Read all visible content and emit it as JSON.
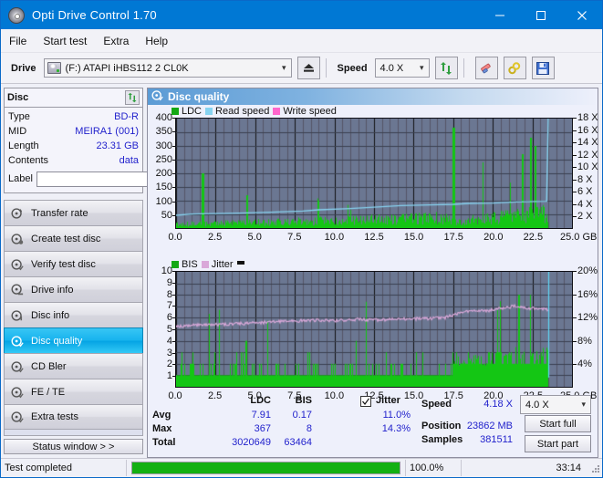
{
  "window": {
    "title": "Opti Drive Control 1.70",
    "app_icon": "disc-icon",
    "minimize": "–",
    "maximize": "□",
    "close": "✕"
  },
  "menu": {
    "items": [
      "File",
      "Start test",
      "Extra",
      "Help"
    ]
  },
  "toolbar": {
    "drive_label": "Drive",
    "drive_value": "(F:)  ATAPI iHBS112  2 CL0K",
    "eject_title": "eject-button",
    "speed_label": "Speed",
    "speed_value": "4.0 X",
    "refresh_title": "refresh-button",
    "erase_title": "erase-button",
    "settings_title": "settings-button",
    "save_title": "save-button"
  },
  "disc_panel": {
    "title": "Disc",
    "rows": [
      {
        "key": "Type",
        "value": "BD-R"
      },
      {
        "key": "MID",
        "value": "MEIRA1 (001)"
      },
      {
        "key": "Length",
        "value": "23.31 GB"
      },
      {
        "key": "Contents",
        "value": "data"
      }
    ],
    "label_key": "Label",
    "label_value": "",
    "label_placeholder": ""
  },
  "nav": {
    "items": [
      {
        "label": "Transfer rate",
        "selected": false
      },
      {
        "label": "Create test disc",
        "selected": false
      },
      {
        "label": "Verify test disc",
        "selected": false
      },
      {
        "label": "Drive info",
        "selected": false
      },
      {
        "label": "Disc info",
        "selected": false
      },
      {
        "label": "Disc quality",
        "selected": true
      },
      {
        "label": "CD Bler",
        "selected": false
      },
      {
        "label": "FE / TE",
        "selected": false
      },
      {
        "label": "Extra tests",
        "selected": false
      }
    ],
    "status_window": "Status window > >"
  },
  "main": {
    "title": "Disc quality",
    "icon": "disc-quality-icon"
  },
  "stats": {
    "col_ldc": "LDC",
    "col_bis": "BIS",
    "row_avg": "Avg",
    "row_max": "Max",
    "row_total": "Total",
    "avg_ldc": "7.91",
    "avg_bis": "0.17",
    "max_ldc": "367",
    "max_bis": "8",
    "total_ldc": "3020649",
    "total_bis": "63464",
    "jitter_label": "Jitter",
    "jitter_checked": true,
    "jitter_avg": "11.0%",
    "jitter_max": "14.3%",
    "speed_label": "Speed",
    "speed_value": "4.18 X",
    "position_label": "Position",
    "position_value": "23862 MB",
    "samples_label": "Samples",
    "samples_value": "381511",
    "speed_select": "4.0 X",
    "start_full": "Start full",
    "start_part": "Start part"
  },
  "statusbar": {
    "text": "Test completed",
    "percent": "100.0%",
    "progress": 100,
    "time": "33:14"
  },
  "colors": {
    "accent": "#0078d4",
    "ldc_green": "#14c614",
    "read_speed": "#87d3f0",
    "write_speed": "#ff66cc",
    "jitter_pink": "#d9a8d9",
    "plot_bg": "#6b7792",
    "value_blue": "#2222cc",
    "progress_green": "#13b013"
  },
  "chart_data": [
    {
      "type": "line",
      "name": "ldc-chart",
      "title": "",
      "xlabel": "GB",
      "ylabel": "",
      "xlim": [
        0,
        25
      ],
      "ylim": [
        0,
        400
      ],
      "y2lim": [
        0,
        18
      ],
      "y2label": "X",
      "xticks": [
        0.0,
        2.5,
        5.0,
        7.5,
        10.0,
        12.5,
        15.0,
        17.5,
        20.0,
        22.5,
        25.0
      ],
      "xticklabels": [
        "0.0",
        "2.5",
        "5.0",
        "7.5",
        "10.0",
        "12.5",
        "15.0",
        "17.5",
        "20.0",
        "22.5",
        "25.0 GB"
      ],
      "yticks": [
        50,
        100,
        150,
        200,
        250,
        300,
        350,
        400
      ],
      "y2ticks": [
        2,
        4,
        6,
        8,
        10,
        12,
        14,
        16,
        18
      ],
      "y2ticklabels": [
        "2 X",
        "4 X",
        "6 X",
        "8 X",
        "10 X",
        "12 X",
        "14 X",
        "16 X",
        "18 X"
      ],
      "grid": true,
      "legend": [
        {
          "label": "LDC",
          "color": "#14a814"
        },
        {
          "label": "Read speed",
          "color": "#87d3f0"
        },
        {
          "label": "Write speed",
          "color": "#ff66cc"
        }
      ],
      "data_end_gb": 23.5,
      "series": [
        {
          "name": "LDC",
          "type": "bar",
          "color": "#14c614",
          "comment": "spiky error counts, baseline ~5-40, spikes to 367 max",
          "baseline": [
            8,
            10,
            9,
            12,
            10,
            14,
            11,
            9,
            13,
            10,
            12,
            9,
            11,
            14,
            10,
            13,
            11,
            9,
            12,
            10,
            14,
            16,
            12,
            10,
            13,
            11,
            15,
            12,
            10,
            14,
            11,
            9,
            13,
            16,
            12,
            10,
            14,
            11,
            13,
            10,
            12,
            15,
            11,
            9,
            13,
            12,
            10,
            14,
            11,
            16,
            12,
            10,
            13,
            11,
            14,
            12,
            16,
            13,
            11,
            15,
            12,
            18,
            14,
            11,
            16,
            13,
            20,
            15,
            12,
            18,
            14,
            22,
            16,
            13,
            20,
            15,
            24,
            18,
            14,
            22,
            17,
            26,
            20,
            15,
            24,
            18,
            28,
            21,
            16,
            26,
            20,
            30,
            23,
            18,
            28,
            22,
            32,
            25,
            19,
            30,
            24,
            34,
            26,
            20,
            32,
            25,
            36,
            28,
            22,
            34,
            27,
            38,
            30,
            24,
            36,
            29,
            40,
            32,
            25,
            38,
            31,
            42,
            34,
            27,
            40,
            33,
            44,
            36,
            28,
            42,
            35,
            46,
            38,
            30,
            44,
            37,
            48,
            40,
            31,
            46,
            39,
            50,
            42,
            33,
            48,
            41,
            52,
            44,
            34,
            50,
            43,
            54,
            46,
            36,
            52,
            45,
            56,
            48,
            37,
            54,
            47,
            58,
            50,
            39,
            56,
            49,
            60,
            52,
            40,
            58,
            51,
            62,
            54,
            42,
            60,
            53,
            64,
            56,
            43,
            62,
            55,
            66,
            58,
            45,
            64,
            57,
            68,
            60,
            46,
            66,
            59,
            70,
            62,
            48,
            68,
            61,
            72,
            64,
            49,
            70,
            63,
            74,
            66,
            51,
            72,
            65,
            76,
            68,
            52,
            74,
            67,
            78,
            70,
            54,
            76,
            69,
            80,
            72,
            55,
            78,
            71,
            82,
            74,
            57,
            80,
            73,
            84,
            76,
            58,
            82,
            75,
            86,
            78,
            60,
            84,
            0,
            0,
            0,
            0,
            0,
            0,
            0,
            0,
            0,
            0,
            0,
            0,
            0,
            0,
            0,
            0,
            0,
            0,
            0,
            0,
            0,
            0,
            0
          ],
          "max": 367
        },
        {
          "name": "Read speed",
          "type": "line",
          "color": "#87d3f0",
          "axis": "y2",
          "comment": "rises slowly from ~2.1X at 0GB to ~4.4X at 23.5GB then vertical drop",
          "points": [
            [
              0,
              2.1
            ],
            [
              1.0,
              2.3
            ],
            [
              1.5,
              2.35
            ],
            [
              4.0,
              2.45
            ],
            [
              6.0,
              2.6
            ],
            [
              8.0,
              2.8
            ],
            [
              9.0,
              3.0
            ],
            [
              11.0,
              3.2
            ],
            [
              13.0,
              3.5
            ],
            [
              14.2,
              3.7
            ],
            [
              16.0,
              3.8
            ],
            [
              17.5,
              3.9
            ],
            [
              18.5,
              4.05
            ],
            [
              20.0,
              4.1
            ],
            [
              21.5,
              4.3
            ],
            [
              23.4,
              4.4
            ],
            [
              23.5,
              18.0
            ]
          ]
        }
      ]
    },
    {
      "type": "line",
      "name": "bis-jitter-chart",
      "title": "",
      "xlabel": "GB",
      "ylabel": "",
      "xlim": [
        0,
        25
      ],
      "ylim": [
        0,
        10
      ],
      "y2lim": [
        0,
        20
      ],
      "y2label": "%",
      "xticks": [
        0.0,
        2.5,
        5.0,
        7.5,
        10.0,
        12.5,
        15.0,
        17.5,
        20.0,
        22.5,
        25.0
      ],
      "xticklabels": [
        "0.0",
        "2.5",
        "5.0",
        "7.5",
        "10.0",
        "12.5",
        "15.0",
        "17.5",
        "20.0",
        "22.5",
        "25.0 GB"
      ],
      "yticks": [
        1,
        2,
        3,
        4,
        5,
        6,
        7,
        8,
        9,
        10
      ],
      "y2ticks": [
        4,
        8,
        12,
        16,
        20
      ],
      "y2ticklabels": [
        "4%",
        "8%",
        "12%",
        "16%",
        "20%"
      ],
      "grid": true,
      "legend": [
        {
          "label": "BIS",
          "color": "#14a814"
        },
        {
          "label": "Jitter",
          "color": "#d9a8d9"
        }
      ],
      "data_end_gb": 23.5,
      "series": [
        {
          "name": "BIS",
          "type": "bar",
          "color": "#14c614",
          "comment": "dense bars mostly 1, many to 2, some 3-4, rises to ~8 after 20GB",
          "max": 8
        },
        {
          "name": "Jitter",
          "type": "line",
          "color": "#d9a8d9",
          "axis": "y2",
          "comment": "noisy line rising from ~10.6% to ~14% then settling ~13.5%",
          "points": [
            [
              0,
              10.5
            ],
            [
              1.0,
              10.7
            ],
            [
              2.5,
              10.8
            ],
            [
              4.0,
              11.0
            ],
            [
              5.5,
              11.2
            ],
            [
              7.0,
              11.4
            ],
            [
              8.5,
              11.6
            ],
            [
              10.0,
              11.5
            ],
            [
              11.5,
              11.7
            ],
            [
              13.0,
              11.6
            ],
            [
              14.5,
              11.8
            ],
            [
              16.0,
              11.9
            ],
            [
              17.0,
              12.0
            ],
            [
              17.6,
              12.6
            ],
            [
              18.5,
              13.1
            ],
            [
              19.5,
              13.2
            ],
            [
              20.5,
              13.6
            ],
            [
              21.3,
              14.0
            ],
            [
              22.0,
              13.7
            ],
            [
              22.8,
              13.6
            ],
            [
              23.4,
              13.4
            ]
          ]
        }
      ],
      "summary": {
        "jitter_avg_pct": 11.0,
        "jitter_max_pct": 14.3
      }
    }
  ]
}
